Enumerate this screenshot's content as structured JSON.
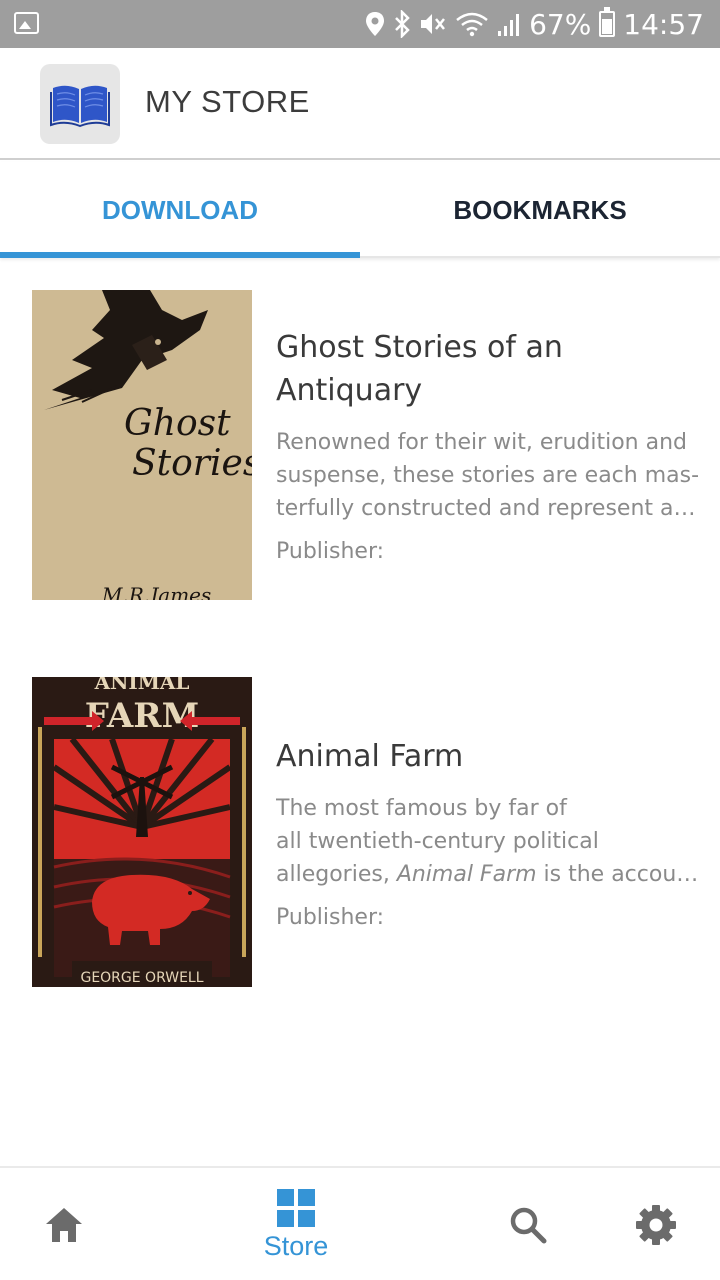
{
  "status_bar": {
    "battery": "67%",
    "time": "14:57",
    "icons": [
      "gallery-icon",
      "location-icon",
      "bluetooth-icon",
      "mute-icon",
      "wifi-icon",
      "signal-icon",
      "battery-icon"
    ]
  },
  "header": {
    "title": "MY STORE",
    "logo_icon": "open-book-icon"
  },
  "tabs": [
    {
      "label": "DOWNLOAD",
      "active": true
    },
    {
      "label": "BOOKMARKS",
      "active": false
    }
  ],
  "books": [
    {
      "title": "Ghost Stories of an Antiquary",
      "description_lines": [
        "Renowned for their wit, erudition and",
        "suspense, these stories are each mas-",
        "terfully constructed and represent a…"
      ],
      "publisher": "Publisher:",
      "cover": {
        "title_line1": "Ghost",
        "title_line2": "Stories",
        "author": "M.R.James",
        "background": "#c9b48e"
      }
    },
    {
      "title": "Animal Farm",
      "description_lines": [
        "The most famous by far of",
        "all twentieth-century political"
      ],
      "description_line3_pre": "allegories, ",
      "description_line3_italic": "Animal Farm",
      "description_line3_post": " is the accou…",
      "publisher": "Publisher:",
      "cover": {
        "title_line1": "ANIMAL",
        "title_line2": "FARM",
        "author": "GEORGE ORWELL",
        "background": "#2a1a14"
      }
    }
  ],
  "bottom_nav": [
    {
      "icon": "home-icon",
      "label": ""
    },
    {
      "icon": "store-grid-icon",
      "label": "Store",
      "active": true
    },
    {
      "icon": "search-icon",
      "label": ""
    },
    {
      "icon": "gear-icon",
      "label": ""
    }
  ],
  "colors": {
    "accent": "#3594d6",
    "nav_icon": "#6b6b6b",
    "status_bar": "#9e9e9e"
  }
}
